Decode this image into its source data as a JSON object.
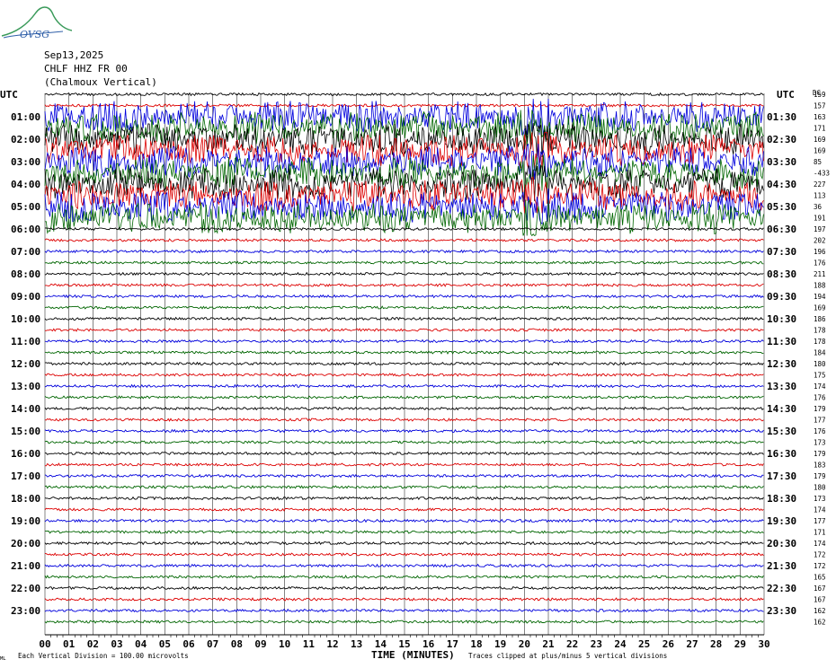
{
  "header": {
    "logo_text": "OVSG",
    "date": "Sep13,2025",
    "channel": "CHLF HHZ FR 00",
    "station_name": "(Chalmoux Vertical)"
  },
  "colors": {
    "cycle": [
      "#000000",
      "#dd0000",
      "#0000dd",
      "#006600"
    ],
    "logo_green": "#3a9a5a",
    "logo_blue": "#2f5fa8"
  },
  "chart_data": {
    "type": "helicorder",
    "left_axis_title": "UTC",
    "right_axis_title": "UTC",
    "dc_title": "DC",
    "xlabel": "TIME (MINUTES)",
    "xlim": [
      0,
      30
    ],
    "x_ticks": [
      "00",
      "01",
      "02",
      "03",
      "04",
      "05",
      "06",
      "07",
      "08",
      "09",
      "10",
      "11",
      "12",
      "13",
      "14",
      "15",
      "16",
      "17",
      "18",
      "19",
      "20",
      "21",
      "22",
      "23",
      "24",
      "25",
      "26",
      "27",
      "28",
      "29",
      "30"
    ],
    "left_labels": [
      "01:00",
      "02:00",
      "03:00",
      "04:00",
      "05:00",
      "06:00",
      "07:00",
      "08:00",
      "09:00",
      "10:00",
      "11:00",
      "12:00",
      "13:00",
      "14:00",
      "15:00",
      "16:00",
      "17:00",
      "18:00",
      "19:00",
      "20:00",
      "21:00",
      "22:00",
      "23:00"
    ],
    "right_labels": [
      "01:30",
      "02:30",
      "03:30",
      "04:30",
      "05:30",
      "06:30",
      "07:30",
      "08:30",
      "09:30",
      "10:30",
      "11:30",
      "12:30",
      "13:30",
      "14:30",
      "15:30",
      "16:30",
      "17:30",
      "18:30",
      "19:30",
      "20:30",
      "21:30",
      "22:30",
      "23:30"
    ],
    "dc_values": [
      "159",
      "157",
      "163",
      "171",
      "169",
      "169",
      "85",
      "-433",
      "227",
      "113",
      "36",
      "191",
      "197",
      "202",
      "196",
      "176",
      "211",
      "188",
      "194",
      "169",
      "186",
      "178",
      "178",
      "184",
      "180",
      "175",
      "174",
      "176",
      "179",
      "177",
      "176",
      "173",
      "179",
      "183",
      "179",
      "180",
      "173",
      "174",
      "177",
      "171",
      "174",
      "172",
      "172",
      "165",
      "167",
      "167",
      "162",
      "162"
    ],
    "event_rows": [
      2,
      3,
      4,
      5,
      6,
      7,
      8,
      9,
      10,
      11
    ],
    "footer_left": "Each Vertical Division =  100.00 microvolts",
    "footer_right": "Traces clipped at plus/minus 5 vertical divisions",
    "corner_mark": "ML"
  }
}
